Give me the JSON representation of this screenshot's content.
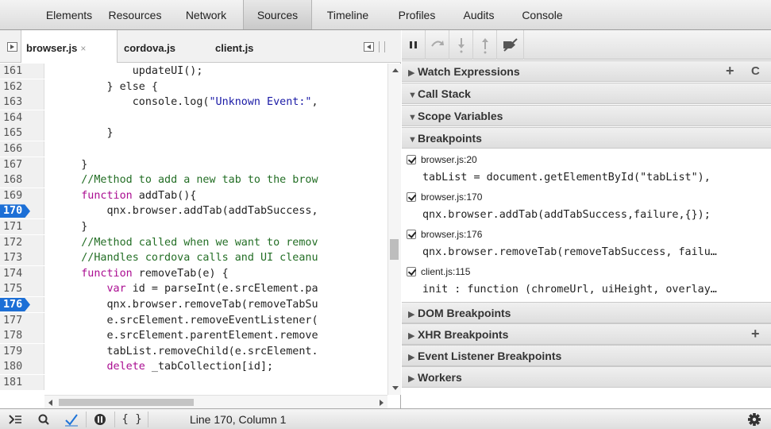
{
  "toolbar": {
    "tabs": [
      "Elements",
      "Resources",
      "Network",
      "Sources",
      "Timeline",
      "Profiles",
      "Audits",
      "Console"
    ],
    "active": "Sources"
  },
  "source": {
    "file_tabs": [
      {
        "label": "browser.js",
        "close": "×",
        "active": true
      },
      {
        "label": "cordova.js"
      },
      {
        "label": "client.js"
      }
    ],
    "lines": [
      {
        "num": "161",
        "text": "            updateUI();"
      },
      {
        "num": "162",
        "text": "        } else {"
      },
      {
        "num": "163",
        "text": "            console.log(",
        "str": "\"Unknown Event:\"",
        "rest": ","
      },
      {
        "num": "164",
        "text": ""
      },
      {
        "num": "165",
        "text": "        }"
      },
      {
        "num": "166",
        "text": ""
      },
      {
        "num": "167",
        "text": "    }"
      },
      {
        "num": "168",
        "text": "    //Method to add a new tab to the brow",
        "type": "comment"
      },
      {
        "num": "169",
        "text": "    function addTab(){",
        "kw": "function"
      },
      {
        "num": "170",
        "text": "        qnx.browser.addTab(addTabSuccess,",
        "bp": true
      },
      {
        "num": "171",
        "text": "    }"
      },
      {
        "num": "172",
        "text": "    //Method called when we want to remov",
        "type": "comment"
      },
      {
        "num": "173",
        "text": "    //Handles cordova calls and UI cleanu",
        "type": "comment"
      },
      {
        "num": "174",
        "text": "    function removeTab(e) {",
        "kw": "function"
      },
      {
        "num": "175",
        "text": "        var id = parseInt(e.srcElement.pa",
        "kw": "var"
      },
      {
        "num": "176",
        "text": "        qnx.browser.removeTab(removeTabSu",
        "bp": true
      },
      {
        "num": "177",
        "text": "        e.srcElement.removeEventListener("
      },
      {
        "num": "178",
        "text": "        e.srcElement.parentElement.remove"
      },
      {
        "num": "179",
        "text": "        tabList.removeChild(e.srcElement."
      },
      {
        "num": "180",
        "text": "        delete _tabCollection[id];",
        "kw": "delete"
      },
      {
        "num": "181",
        "text": ""
      }
    ]
  },
  "sidebar": {
    "watch_expressions": "Watch Expressions",
    "call_stack": "Call Stack",
    "scope_variables": "Scope Variables",
    "breakpoints_title": "Breakpoints",
    "breakpoints": [
      {
        "file": "browser.js:20",
        "code": "tabList = document.getElementById(\"tabList\"),"
      },
      {
        "file": "browser.js:170",
        "code": "qnx.browser.addTab(addTabSuccess,failure,{});"
      },
      {
        "file": "browser.js:176",
        "code": "qnx.browser.removeTab(removeTabSuccess, failu…"
      },
      {
        "file": "client.js:115",
        "code": "init : function (chromeUrl, uiHeight, overlay…"
      }
    ],
    "dom_breakpoints": "DOM Breakpoints",
    "xhr_breakpoints": "XHR Breakpoints",
    "event_listener_breakpoints": "Event Listener Breakpoints",
    "workers": "Workers",
    "plus": "+",
    "refresh": "C"
  },
  "status": {
    "text": "Line 170, Column 1",
    "braces": "{ }"
  },
  "colors": {
    "breakpoint_blue": "#1c6fd6",
    "comment_green": "#236e25",
    "keyword_purple": "#aa0d91",
    "string_blue": "#1a1aa6",
    "checkmark_blue": "#1e73d8"
  }
}
